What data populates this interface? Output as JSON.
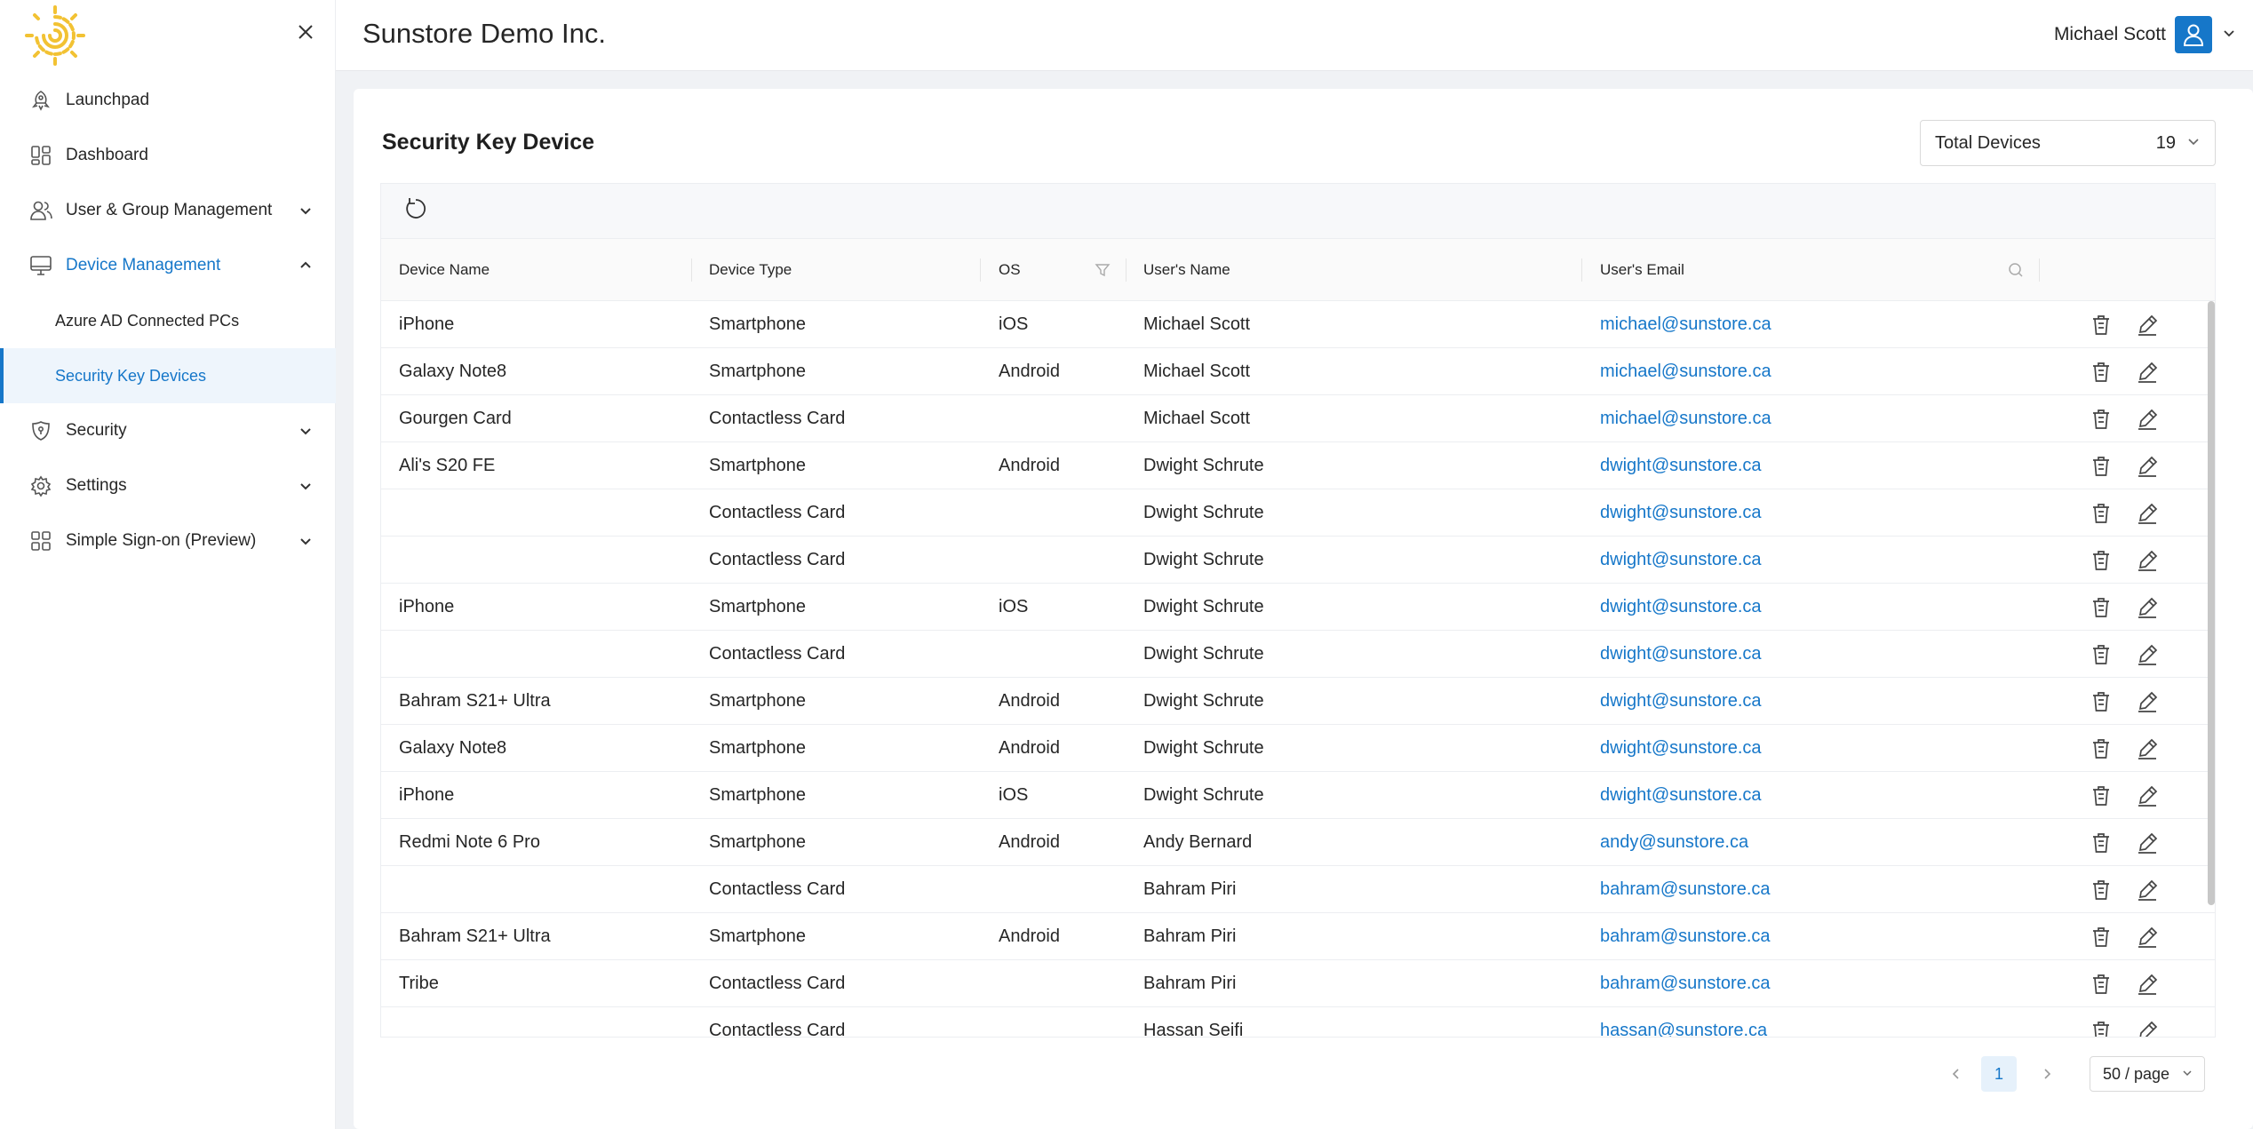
{
  "header": {
    "company": "Sunstore Demo Inc.",
    "user_name": "Michael Scott"
  },
  "sidebar": {
    "items": [
      {
        "label": "Launchpad",
        "icon": "rocket-icon"
      },
      {
        "label": "Dashboard",
        "icon": "dashboard-icon"
      },
      {
        "label": "User & Group Management",
        "icon": "users-icon"
      },
      {
        "label": "Device Management",
        "icon": "monitor-icon"
      },
      {
        "label": "Azure AD Connected PCs"
      },
      {
        "label": "Security Key Devices"
      },
      {
        "label": "Security",
        "icon": "shield-icon"
      },
      {
        "label": "Settings",
        "icon": "gear-icon"
      },
      {
        "label": "Simple Sign-on (Preview)",
        "icon": "apps-icon"
      }
    ]
  },
  "main": {
    "title": "Security Key Device",
    "total_label": "Total Devices",
    "total_count": "19",
    "columns": [
      "Device Name",
      "Device Type",
      "OS",
      "User's Name",
      "User's Email"
    ],
    "rows": [
      [
        "iPhone",
        "Smartphone",
        "iOS",
        "Michael Scott",
        "michael@sunstore.ca"
      ],
      [
        "Galaxy Note8",
        "Smartphone",
        "Android",
        "Michael Scott",
        "michael@sunstore.ca"
      ],
      [
        "Gourgen Card",
        "Contactless Card",
        "",
        "Michael Scott",
        "michael@sunstore.ca"
      ],
      [
        "Ali's S20 FE",
        "Smartphone",
        "Android",
        "Dwight Schrute",
        "dwight@sunstore.ca"
      ],
      [
        "",
        "Contactless Card",
        "",
        "Dwight Schrute",
        "dwight@sunstore.ca"
      ],
      [
        "",
        "Contactless Card",
        "",
        "Dwight Schrute",
        "dwight@sunstore.ca"
      ],
      [
        "iPhone",
        "Smartphone",
        "iOS",
        "Dwight Schrute",
        "dwight@sunstore.ca"
      ],
      [
        "",
        "Contactless Card",
        "",
        "Dwight Schrute",
        "dwight@sunstore.ca"
      ],
      [
        "Bahram S21+ Ultra",
        "Smartphone",
        "Android",
        "Dwight Schrute",
        "dwight@sunstore.ca"
      ],
      [
        "Galaxy Note8",
        "Smartphone",
        "Android",
        "Dwight Schrute",
        "dwight@sunstore.ca"
      ],
      [
        "iPhone",
        "Smartphone",
        "iOS",
        "Dwight Schrute",
        "dwight@sunstore.ca"
      ],
      [
        "Redmi Note 6 Pro",
        "Smartphone",
        "Android",
        "Andy Bernard",
        "andy@sunstore.ca"
      ],
      [
        "",
        "Contactless Card",
        "",
        "Bahram Piri",
        "bahram@sunstore.ca"
      ],
      [
        "Bahram S21+ Ultra",
        "Smartphone",
        "Android",
        "Bahram Piri",
        "bahram@sunstore.ca"
      ],
      [
        "Tribe",
        "Contactless Card",
        "",
        "Bahram Piri",
        "bahram@sunstore.ca"
      ],
      [
        "",
        "Contactless Card",
        "",
        "Hassan Seifi",
        "hassan@sunstore.ca"
      ]
    ]
  },
  "pagination": {
    "current_page": "1",
    "page_size": "50 / page"
  },
  "colors": {
    "accent": "#1677c9",
    "logo": "#f2c233"
  }
}
